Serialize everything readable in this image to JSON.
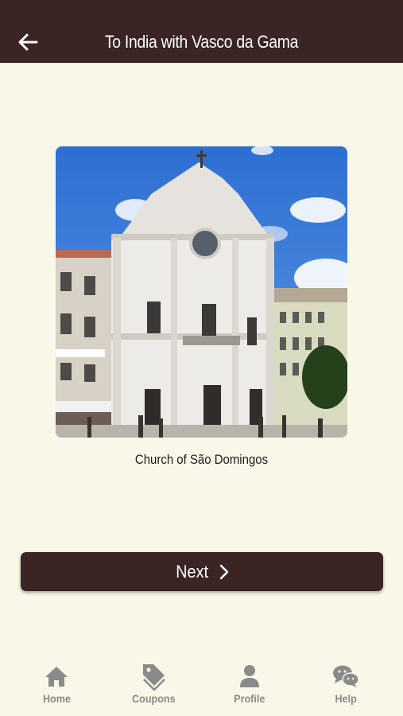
{
  "header": {
    "title": "To India with Vasco da Gama",
    "back_icon": "back-arrow-icon"
  },
  "main": {
    "caption": "Church of São Domingos",
    "next_label": "Next",
    "next_icon": "chevron-right-icon"
  },
  "tabbar": {
    "items": [
      {
        "label": "Home",
        "icon": "home-icon"
      },
      {
        "label": "Coupons",
        "icon": "tag-icon"
      },
      {
        "label": "Profile",
        "icon": "person-icon"
      },
      {
        "label": "Help",
        "icon": "chat-bubbles-icon"
      }
    ]
  },
  "colors": {
    "header_bg": "#3b2424",
    "page_bg": "#f8f7e8",
    "button_bg": "#3b2424",
    "tab_inactive": "#8a8a8a"
  }
}
